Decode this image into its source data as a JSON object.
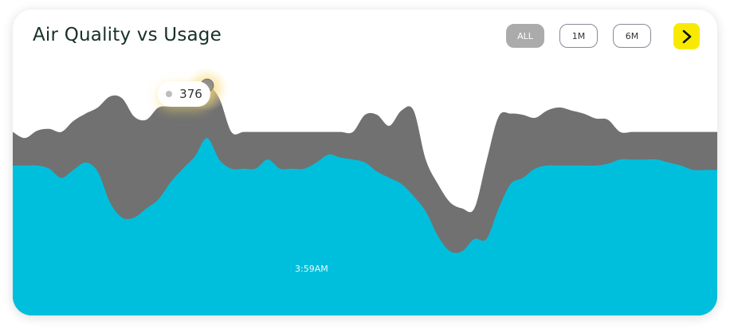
{
  "card": {
    "title": "Air Quality vs Usage"
  },
  "controls": {
    "ranges": [
      {
        "label": "ALL",
        "active": true
      },
      {
        "label": "1M",
        "active": false
      },
      {
        "label": "6M",
        "active": false
      }
    ],
    "next_icon": "chevron-right-icon",
    "accent_color": "#f7ea00"
  },
  "chart_data": {
    "type": "area",
    "x": [
      0,
      0.25,
      0.5,
      0.75,
      1,
      1.25,
      1.5,
      1.75,
      2,
      2.25,
      2.5,
      2.75,
      3,
      3.25,
      3.5,
      3.75,
      4,
      4.25,
      4.5,
      4.75,
      5,
      5.25,
      5.5,
      5.75,
      6,
      6.25,
      6.5,
      6.75,
      7,
      7.25,
      7.5,
      7.75,
      8,
      8.25,
      8.5,
      8.75,
      9,
      9.25,
      9.5,
      9.75,
      10,
      10.25,
      10.5,
      10.75,
      11,
      11.25,
      11.5,
      11.75,
      12,
      12.25,
      12.5,
      12.75,
      13,
      13.25,
      13.5,
      13.75,
      14,
      14.25,
      14.5
    ],
    "series": [
      {
        "values": [
          300,
          290,
          302,
          305,
          300,
          318,
          330,
          340,
          358,
          355,
          325,
          320,
          340,
          342,
          350,
          362,
          376,
          355,
          300,
          300,
          300,
          300,
          300,
          300,
          300,
          300,
          300,
          300,
          300,
          328,
          328,
          310,
          335,
          335,
          255,
          215,
          185,
          175,
          175,
          252,
          325,
          330,
          328,
          323,
          335,
          340,
          335,
          330,
          322,
          320,
          300,
          300,
          300,
          300,
          300,
          300,
          300,
          300,
          300
        ],
        "color": "#717171"
      },
      {
        "values": [
          245,
          245,
          245,
          240,
          225,
          238,
          250,
          235,
          185,
          160,
          160,
          175,
          190,
          218,
          240,
          260,
          290,
          255,
          240,
          240,
          240,
          255,
          240,
          240,
          240,
          250,
          263,
          258,
          255,
          250,
          235,
          225,
          215,
          195,
          170,
          130,
          105,
          105,
          125,
          125,
          175,
          215,
          225,
          240,
          245,
          245,
          245,
          245,
          245,
          248,
          255,
          255,
          255,
          255,
          250,
          245,
          238,
          238,
          238
        ],
        "color": "#00bfdc"
      }
    ],
    "ylim": [
      0,
      500
    ],
    "grid": false,
    "highlight": {
      "index": 16,
      "value": "376",
      "time": "3:59AM"
    }
  }
}
